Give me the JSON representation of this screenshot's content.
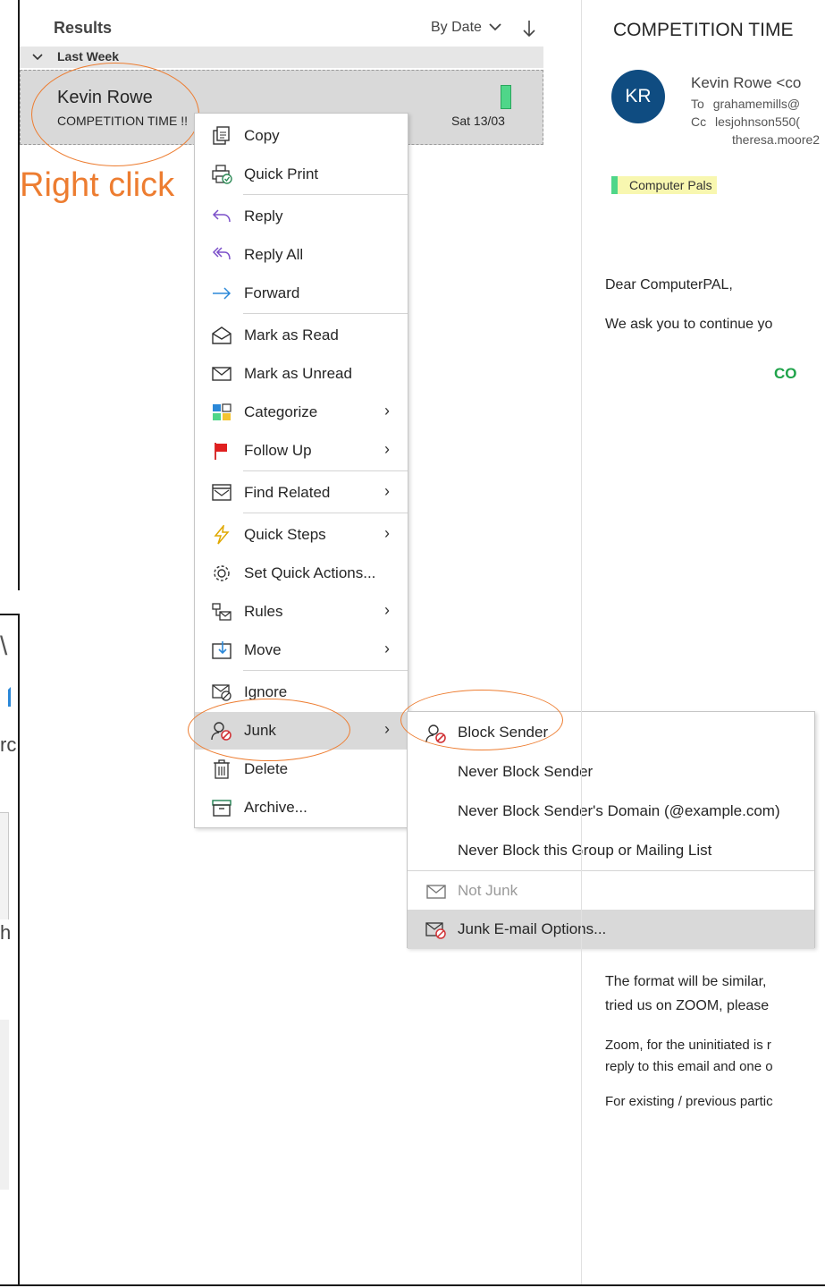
{
  "results": {
    "title": "Results",
    "sort_label": "By Date",
    "sort_chevron": "chevron-down-icon",
    "sort_direction_icon": "arrow-down-icon",
    "group_label": "Last Week",
    "item": {
      "sender": "Kevin Rowe",
      "subject": "COMPETITION TIME !!",
      "date": "Sat 13/03",
      "category_color": "#4fd689"
    }
  },
  "annotation": {
    "text": "Right click",
    "color": "#ed7d31"
  },
  "context_menu": {
    "items": [
      {
        "label": "Copy",
        "icon": "copy-icon"
      },
      {
        "label": "Quick Print",
        "icon": "print-icon"
      },
      {
        "label": "Reply",
        "icon": "reply-icon"
      },
      {
        "label": "Reply All",
        "icon": "reply-all-icon"
      },
      {
        "label": "Forward",
        "icon": "forward-icon"
      },
      {
        "label": "Mark as Read",
        "icon": "envelope-open-icon"
      },
      {
        "label": "Mark as Unread",
        "icon": "envelope-icon"
      },
      {
        "label": "Categorize",
        "icon": "categorize-icon"
      },
      {
        "label": "Follow Up",
        "icon": "flag-icon"
      },
      {
        "label": "Find Related",
        "icon": "find-related-icon"
      },
      {
        "label": "Quick Steps",
        "icon": "lightning-icon"
      },
      {
        "label": "Set Quick Actions...",
        "icon": "gear-icon"
      },
      {
        "label": "Rules",
        "icon": "rules-icon"
      },
      {
        "label": "Move",
        "icon": "move-icon"
      },
      {
        "label": "Ignore",
        "icon": "ignore-icon"
      },
      {
        "label": "Junk",
        "icon": "junk-icon"
      },
      {
        "label": "Delete",
        "icon": "trash-icon"
      },
      {
        "label": "Archive...",
        "icon": "archive-icon"
      }
    ],
    "submenu_arrow": "›"
  },
  "junk_submenu": {
    "items": [
      {
        "label": "Block Sender",
        "icon": "block-sender-icon"
      },
      {
        "label": "Never Block Sender"
      },
      {
        "label": "Never Block Sender's Domain (@example.com)"
      },
      {
        "label": "Never Block this Group or Mailing List"
      },
      {
        "label": "Not Junk",
        "icon": "envelope-icon",
        "disabled": true
      },
      {
        "label": "Junk E-mail Options...",
        "icon": "junk-options-icon"
      }
    ]
  },
  "reading_pane": {
    "subject": "COMPETITION TIME",
    "avatar_initials": "KR",
    "avatar_color": "#0f4c81",
    "from": "Kevin Rowe <co",
    "to_label": "To",
    "to_value": "grahamemills@",
    "cc_label": "Cc",
    "cc_value": "lesjohnson550(",
    "cc_value2": "theresa.moore2",
    "category": "Computer Pals",
    "body": {
      "greeting": "Dear ComputerPAL,",
      "line1": "We ask you to continue yo",
      "heading": "CO",
      "para1a": "The format will be similar,",
      "para1b": "tried us on ZOOM, please",
      "para2a": "Zoom, for the uninitiated is r",
      "para2b": "reply to this email and one o",
      "para3": "For existing / previous partic"
    }
  },
  "back_window": {
    "frag1": "\\",
    "frag2": "rc",
    "frag3": "h"
  }
}
